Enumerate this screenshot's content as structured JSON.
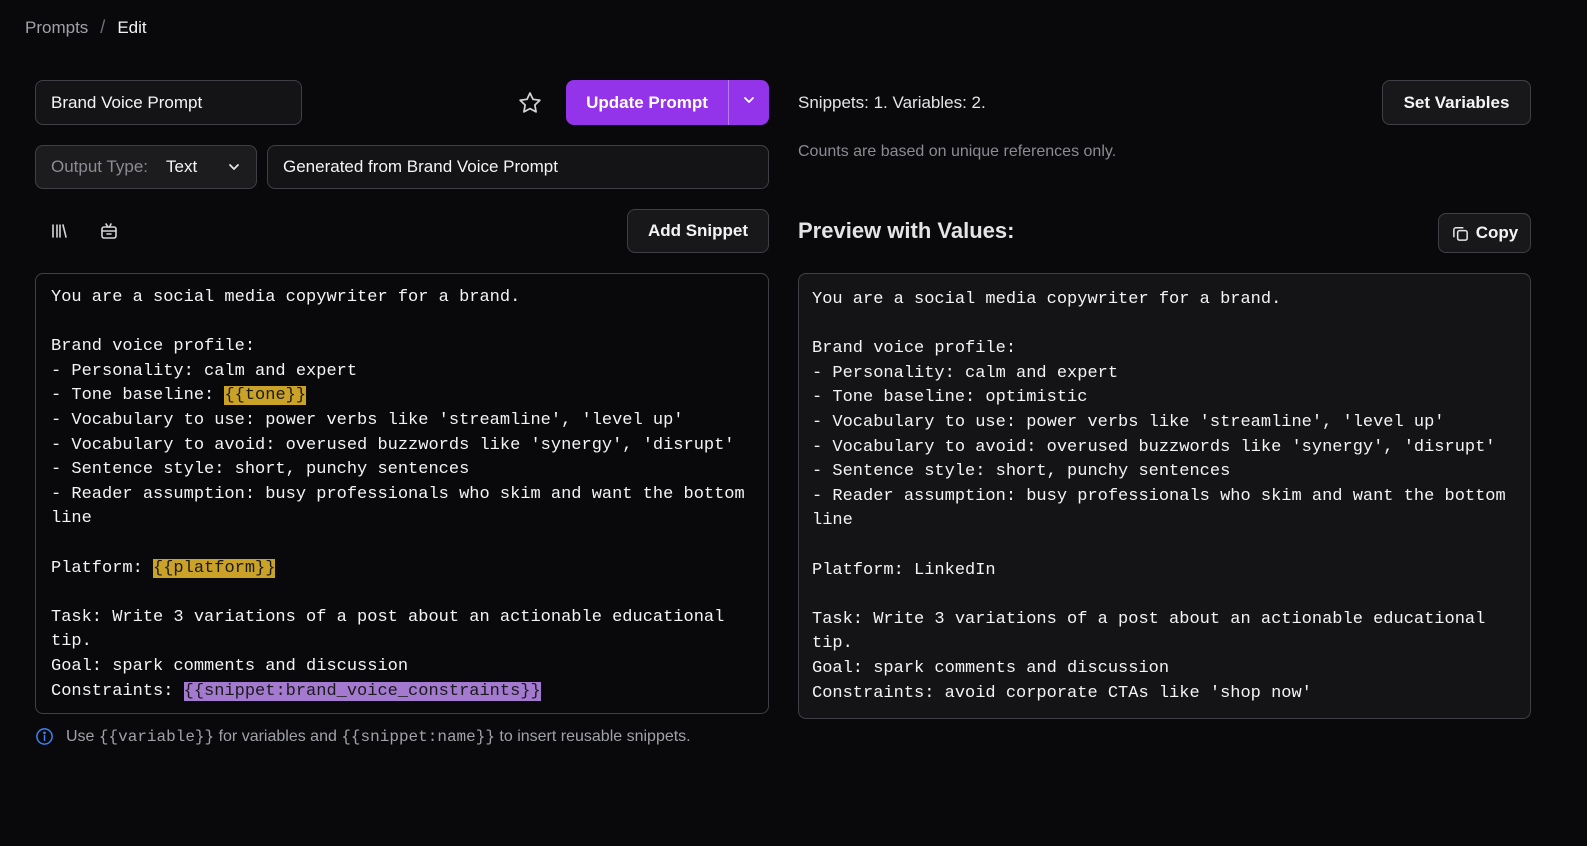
{
  "breadcrumb": {
    "root": "Prompts",
    "separator": "/",
    "current": "Edit"
  },
  "prompt_name": {
    "value": "Brand Voice Prompt"
  },
  "actions": {
    "update_label": "Update Prompt",
    "set_variables_label": "Set Variables",
    "add_snippet_label": "Add Snippet",
    "copy_label": "Copy"
  },
  "output_type": {
    "label": "Output Type:",
    "value": "Text"
  },
  "description": {
    "value": "Generated from Brand Voice Prompt"
  },
  "counts": {
    "summary": "Snippets: 1. Variables: 2.",
    "note": "Counts are based on unique references only."
  },
  "preview": {
    "title": "Preview with Values:"
  },
  "editor": {
    "p1": "You are a social media copywriter for a brand.\n\nBrand voice profile:\n- Personality: calm and expert\n- Tone baseline: ",
    "var_tone": "{{tone}}",
    "p2": "\n- Vocabulary to use: power verbs like 'streamline', 'level up'\n- Vocabulary to avoid: overused buzzwords like 'synergy', 'disrupt'\n- Sentence style: short, punchy sentences\n- Reader assumption: busy professionals who skim and want the bottom line\n\nPlatform: ",
    "var_platform": "{{platform}}",
    "p3": "\n\nTask: Write 3 variations of a post about an actionable educational tip.\nGoal: spark comments and discussion\nConstraints: ",
    "snippet_ref": "{{snippet:brand_voice_constraints}}"
  },
  "preview_text": "You are a social media copywriter for a brand.\n\nBrand voice profile:\n- Personality: calm and expert\n- Tone baseline: optimistic\n- Vocabulary to use: power verbs like 'streamline', 'level up'\n- Vocabulary to avoid: overused buzzwords like 'synergy', 'disrupt'\n- Sentence style: short, punchy sentences\n- Reader assumption: busy professionals who skim and want the bottom line\n\nPlatform: LinkedIn\n\nTask: Write 3 variations of a post about an actionable educational tip.\nGoal: spark comments and discussion\nConstraints: avoid corporate CTAs like 'shop now'",
  "hint": {
    "use": "Use",
    "var_token": "{{variable}}",
    "middle": "for variables and",
    "snippet_token": "{{snippet:name}}",
    "end": "to insert reusable snippets."
  },
  "icons": {
    "star": "star-icon",
    "caret": "chevron-down-icon",
    "library": "library-icon",
    "snippet": "snippet-box-icon",
    "copy": "copy-icon",
    "info": "info-icon"
  },
  "colors": {
    "accent": "#9333ea",
    "variable_highlight": "#c9a227",
    "snippet_highlight": "#a37ad0",
    "background": "#09090b"
  }
}
